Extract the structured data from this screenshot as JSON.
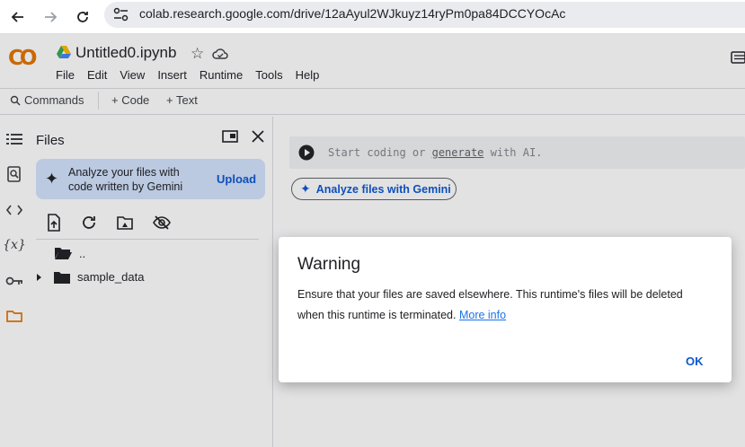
{
  "browser": {
    "url": "colab.research.google.com/drive/12aAyul2WJkuyz14ryPm0pa84DCCYOcAc"
  },
  "app": {
    "logo_text": "CO",
    "notebook_title": "Untitled0.ipynb",
    "menu": [
      "File",
      "Edit",
      "View",
      "Insert",
      "Runtime",
      "Tools",
      "Help"
    ]
  },
  "toolbar": {
    "commands": "Commands",
    "code": "+ Code",
    "text": "+ Text"
  },
  "files_panel": {
    "title": "Files",
    "gemini_prompt": "Analyze your files with code written by Gemini",
    "upload_label": "Upload",
    "entries": [
      {
        "name": ".."
      },
      {
        "name": "sample_data"
      }
    ]
  },
  "notebook": {
    "cell_placeholder_start": "Start coding or ",
    "cell_placeholder_link": "generate",
    "cell_placeholder_end": " with AI.",
    "gemini_button": "Analyze files with Gemini"
  },
  "dialog": {
    "title": "Warning",
    "body": "Ensure that your files are saved elsewhere. This runtime's files will be deleted when this runtime is terminated.",
    "link": "More info",
    "ok_label": "OK"
  },
  "colors": {
    "accent": "#0b57d0",
    "logo": "#e37400",
    "gemini_box": "#d3e3fd"
  }
}
